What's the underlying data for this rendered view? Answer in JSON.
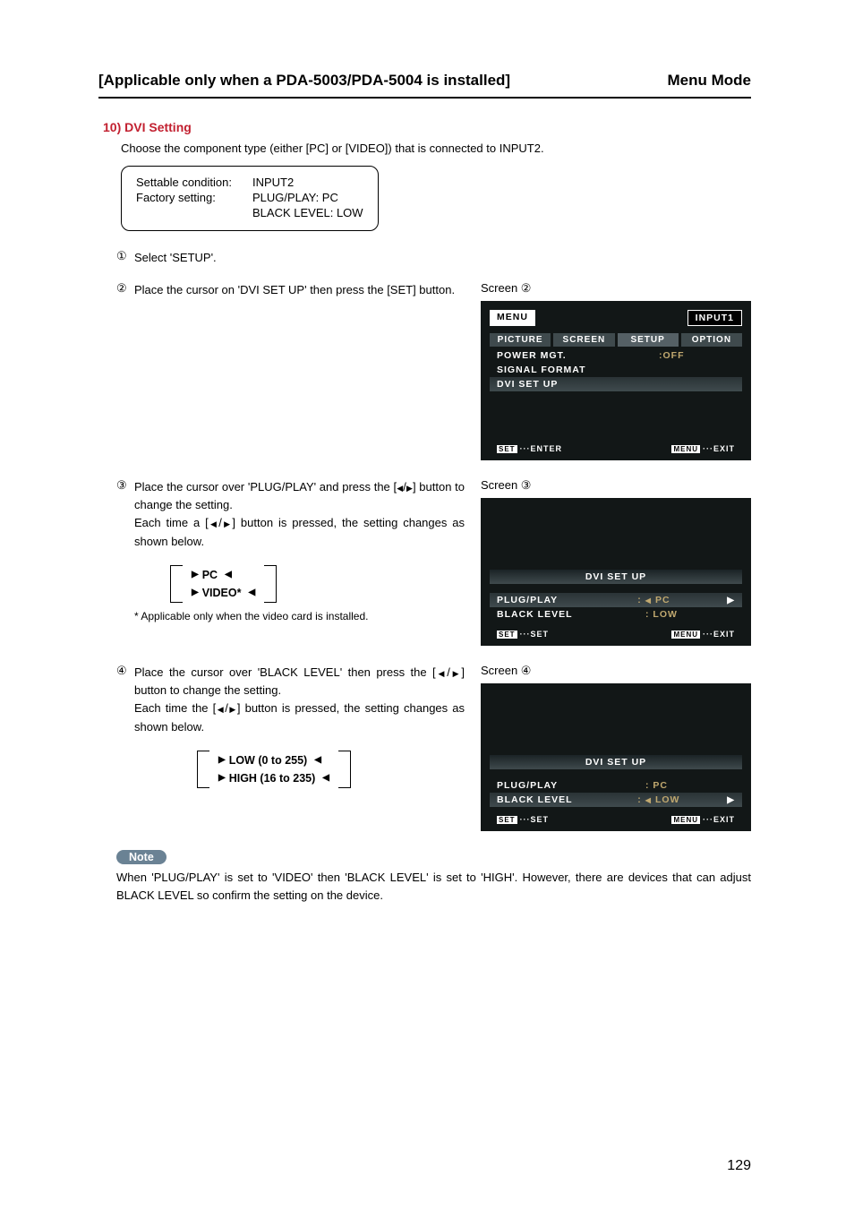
{
  "header": {
    "title_left": "[Applicable only when a PDA-5003/PDA-5004 is installed]",
    "title_right": "Menu Mode"
  },
  "section": {
    "heading": "10) DVI Setting",
    "intro": "Choose the component type (either [PC] or [VIDEO]) that is connected to INPUT2."
  },
  "settings_box": {
    "cond_label": "Settable condition:",
    "cond_value": "INPUT2",
    "factory_label": "Factory setting:",
    "factory_value1": "PLUG/PLAY: PC",
    "factory_value2": "BLACK LEVEL: LOW"
  },
  "steps": {
    "s1_num": "①",
    "s1": "Select 'SETUP'.",
    "s2_num": "②",
    "s2": "Place the cursor on 'DVI SET UP' then press the [SET] button.",
    "s3_num": "③",
    "s3a": "Place the cursor over 'PLUG/PLAY' and press the [",
    "s3b": "] button to change the setting.",
    "s3c": "Each time a [",
    "s3d": "] button is pressed, the setting changes as shown below.",
    "s4_num": "④",
    "s4a": "Place the cursor over 'BLACK LEVEL' then press the [",
    "s4b": "] button to change the setting.",
    "s4c": "Each time the [",
    "s4d": "] button is pressed, the setting changes as shown below."
  },
  "cycle1": {
    "opt1": "PC",
    "opt2": "VIDEO*"
  },
  "cycle2": {
    "opt1": "LOW (0 to 255)",
    "opt2": "HIGH (16 to 235)"
  },
  "footnote": "* Applicable only when the video card is installed.",
  "screens": {
    "label2": "Screen ②",
    "label3": "Screen ③",
    "label4": "Screen ④"
  },
  "osd2": {
    "menu": "MENU",
    "input": "INPUT1",
    "tab1": "PICTURE",
    "tab2": "SCREEN",
    "tab3": "SETUP",
    "tab4": "OPTION",
    "item1": "POWER MGT.",
    "item1v": ":OFF",
    "item2": "SIGNAL FORMAT",
    "item3": "DVI SET UP",
    "foot_set": "SET",
    "foot_enter": "···ENTER",
    "foot_menu": "MENU",
    "foot_exit": "···EXIT"
  },
  "osd3": {
    "title": "DVI SET UP",
    "r1": "PLUG/PLAY",
    "r1v": "PC",
    "r2": "BLACK LEVEL",
    "r2v": ":   LOW",
    "foot_set": "SET",
    "foot_setv": "···SET",
    "foot_menu": "MENU",
    "foot_exit": "···EXIT"
  },
  "osd4": {
    "title": "DVI SET UP",
    "r1": "PLUG/PLAY",
    "r1v": ":   PC",
    "r2": "BLACK LEVEL",
    "r2v": "LOW",
    "foot_set": "SET",
    "foot_setv": "···SET",
    "foot_menu": "MENU",
    "foot_exit": "···EXIT"
  },
  "note": {
    "label": "Note",
    "text": "When 'PLUG/PLAY' is set to 'VIDEO' then 'BLACK LEVEL' is set to 'HIGH'. However, there are devices that can adjust BLACK LEVEL so confirm the setting on the device."
  },
  "page_number": "129"
}
